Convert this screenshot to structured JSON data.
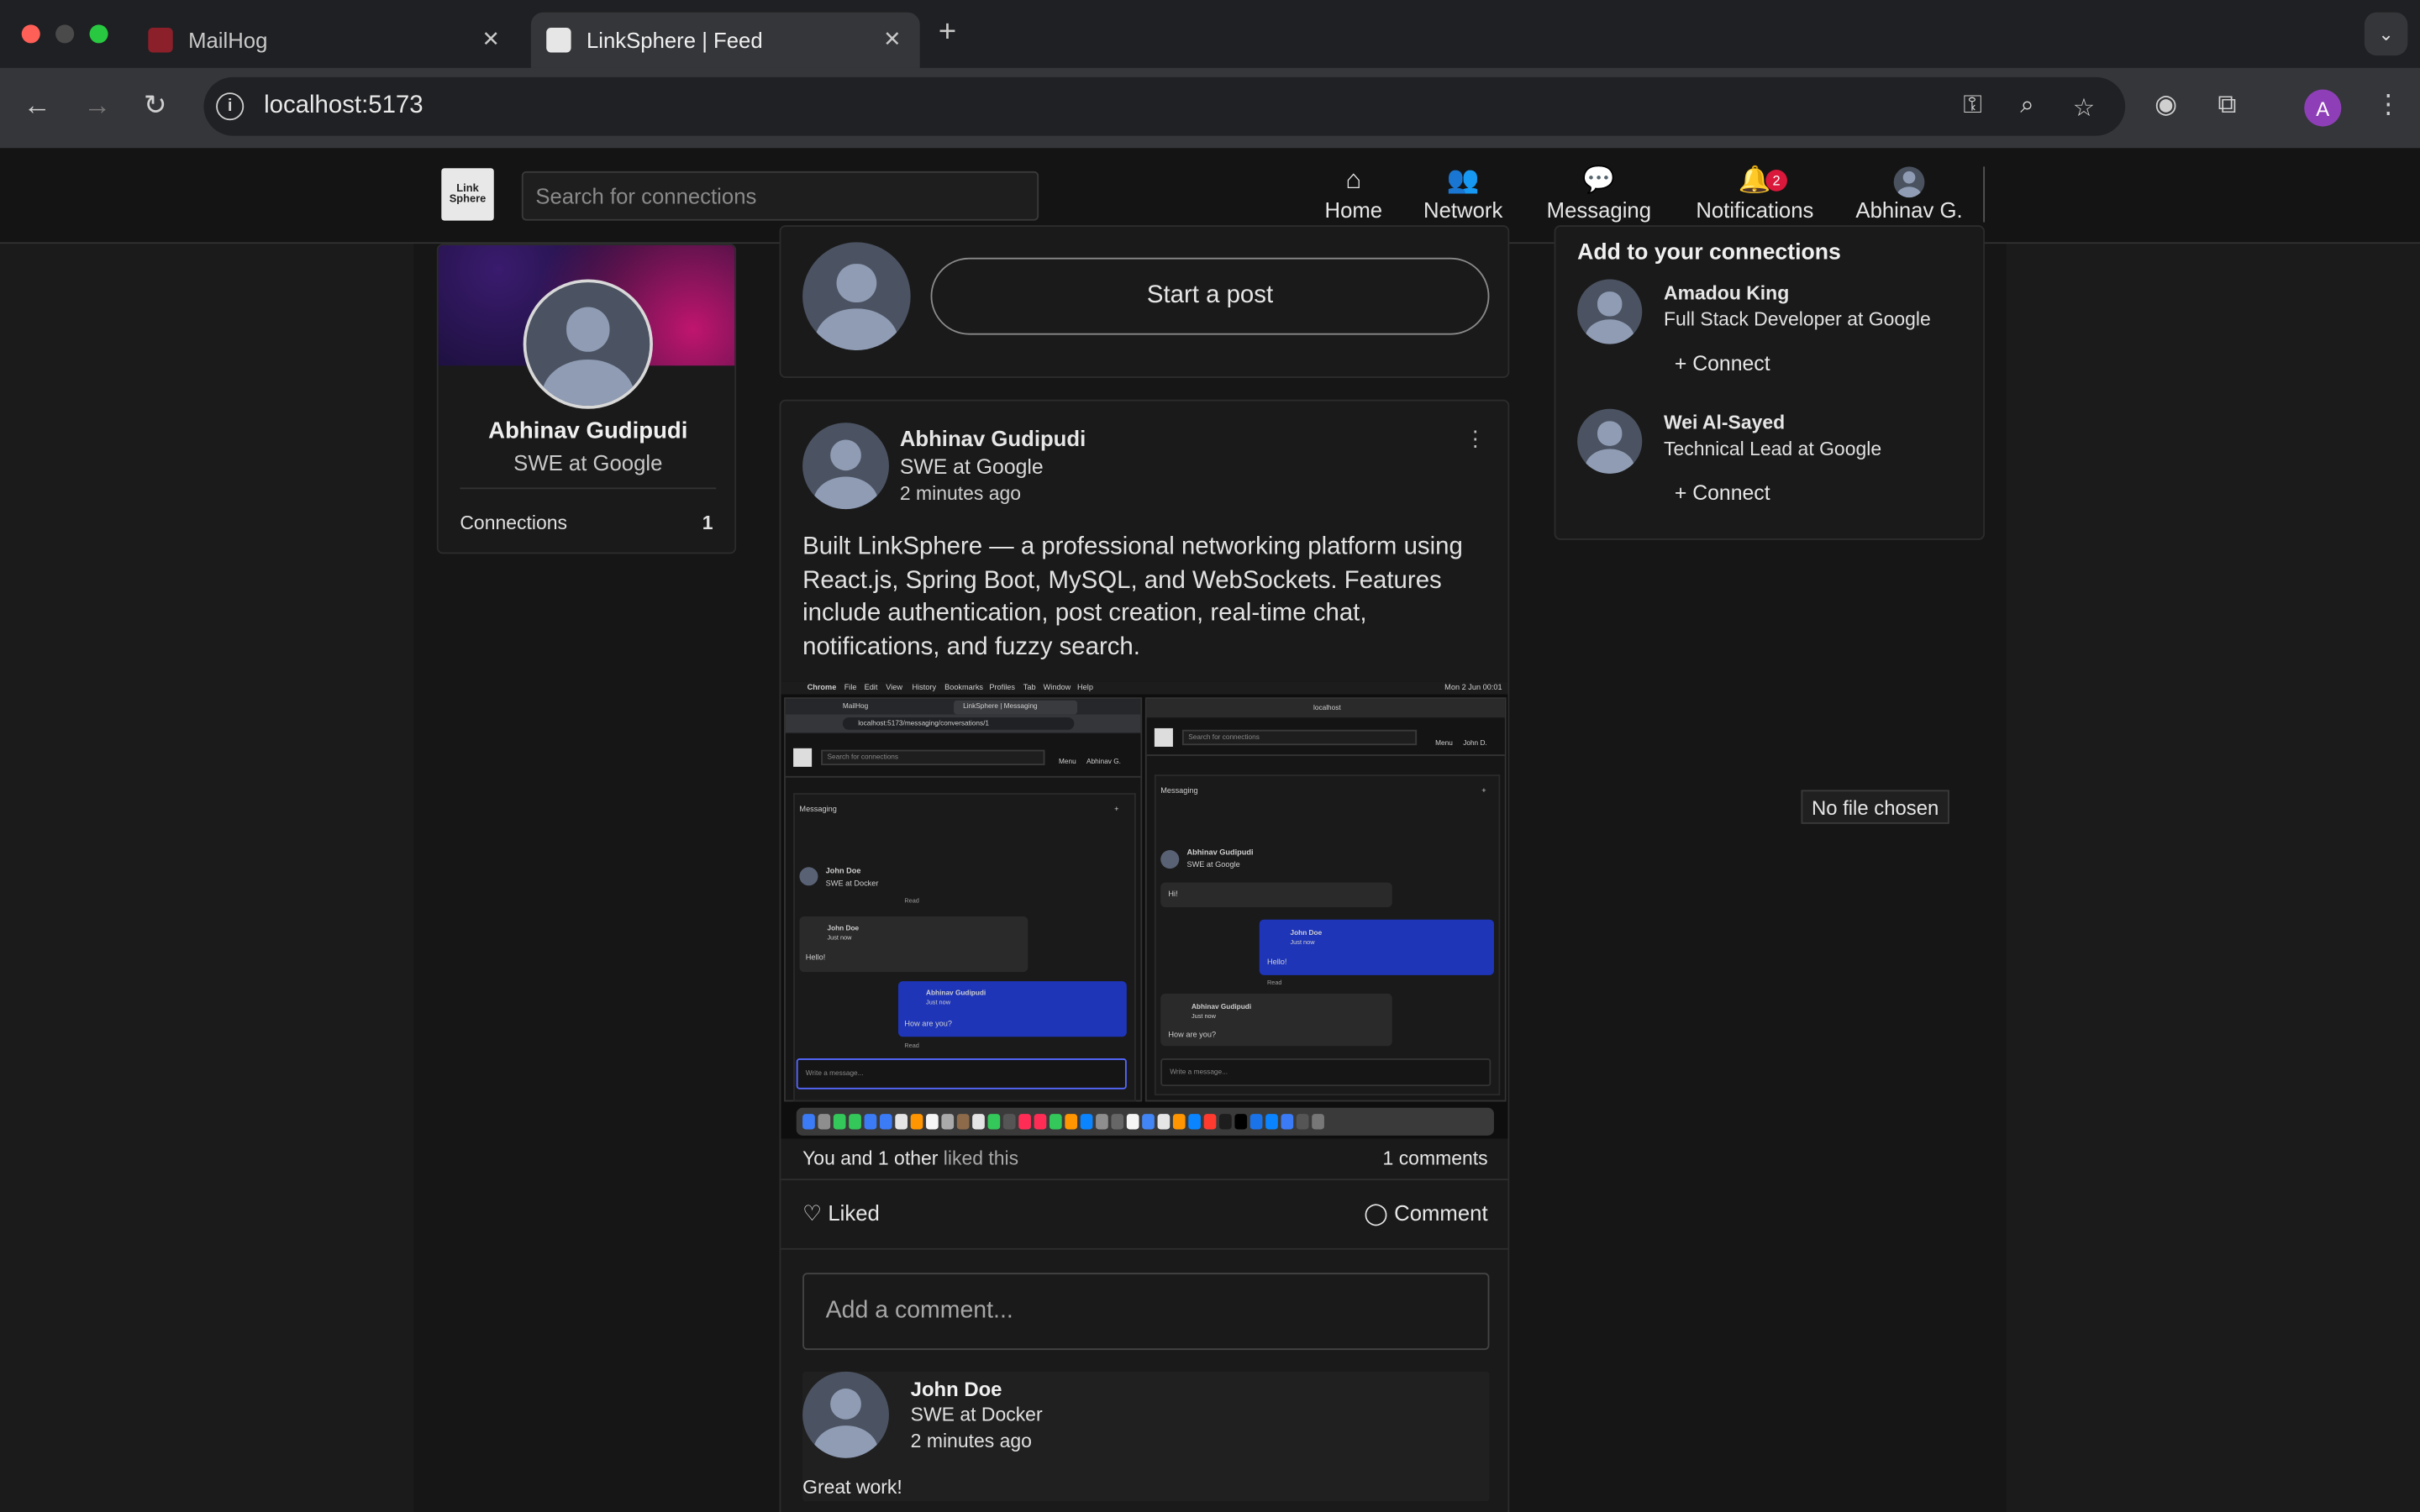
{
  "browser": {
    "tabs": [
      {
        "title": "MailHog",
        "active": false
      },
      {
        "title": "LinkSphere | Feed",
        "active": true
      }
    ],
    "url": "localhost:5173",
    "profile_initial": "A"
  },
  "app": {
    "logo_text": "Link Sphere",
    "search_placeholder": "Search for connections",
    "nav": [
      {
        "label": "Home",
        "icon": "home-icon"
      },
      {
        "label": "Network",
        "icon": "network-icon"
      },
      {
        "label": "Messaging",
        "icon": "messaging-icon"
      },
      {
        "label": "Notifications",
        "icon": "bell-icon",
        "badge": "2"
      },
      {
        "label": "Abhinav G.",
        "icon": "avatar"
      }
    ]
  },
  "profile_card": {
    "name": "Abhinav Gudipudi",
    "headline": "SWE at Google",
    "connections_label": "Connections",
    "connections_count": "1"
  },
  "composer": {
    "button_label": "Start a post"
  },
  "post": {
    "author": "Abhinav Gudipudi",
    "headline": "SWE at Google",
    "time": "2 minutes ago",
    "body": "Built LinkSphere — a professional networking platform using React.js, Spring Boot, MySQL, and WebSockets. Features include authentication, post creation, real-time chat, notifications, and fuzzy search.",
    "likes_you": "You and 1 other",
    "likes_suffix": "liked this",
    "comments_count": "1 comments",
    "like_label": "Liked",
    "comment_label": "Comment",
    "comment_placeholder": "Add a comment...",
    "screenshot": {
      "menubar": [
        "Chrome",
        "File",
        "Edit",
        "View",
        "History",
        "Bookmarks",
        "Profiles",
        "Tab",
        "Window",
        "Help"
      ],
      "menubar_right": "Mon 2 Jun 00:01",
      "left_window": {
        "tab1": "MailHog",
        "tab2": "LinkSphere | Messaging",
        "url": "localhost:5173/messaging/conversations/1",
        "search": "Search for connections",
        "nav_menu": "Menu",
        "nav_user": "Abhinav G.",
        "heading": "Messaging",
        "contact_name": "John Doe",
        "contact_headline": "SWE at Docker",
        "read": "Read",
        "msg1_author": "John Doe",
        "msg1_time": "Just now",
        "msg1_text": "Hello!",
        "msg2_author": "Abhinav Gudipudi",
        "msg2_time": "Just now",
        "msg2_text": "How are you?",
        "input_placeholder": "Write a message..."
      },
      "right_window": {
        "url": "localhost",
        "search": "Search for connections",
        "nav_menu": "Menu",
        "nav_user": "John D.",
        "heading": "Messaging",
        "contact_name": "Abhinav Gudipudi",
        "contact_headline": "SWE at Google",
        "msg0_text": "Hi!",
        "msg1_author": "John Doe",
        "msg1_time": "Just now",
        "msg1_text": "Hello!",
        "read": "Read",
        "msg2_author": "Abhinav Gudipudi",
        "msg2_time": "Just now",
        "msg2_text": "How are you?",
        "input_placeholder": "Write a message..."
      }
    },
    "comment": {
      "author": "John Doe",
      "headline": "SWE at Docker",
      "time": "2 minutes ago",
      "text": "Great work!"
    }
  },
  "suggestions": {
    "title": "Add to your connections",
    "people": [
      {
        "name": "Amadou King",
        "headline": "Full Stack Developer at Google",
        "action": "+ Connect"
      },
      {
        "name": "Wei Al-Sayed",
        "headline": "Technical Lead at Google",
        "action": "+ Connect"
      }
    ]
  },
  "file_input": {
    "label": "No file chosen"
  },
  "colors": {
    "background": "#1b1b1b",
    "card": "#1a1a1a",
    "badge": "#d9183b",
    "message_bubble": "#1e35b8",
    "profile_accent": "#8e3fb8"
  }
}
